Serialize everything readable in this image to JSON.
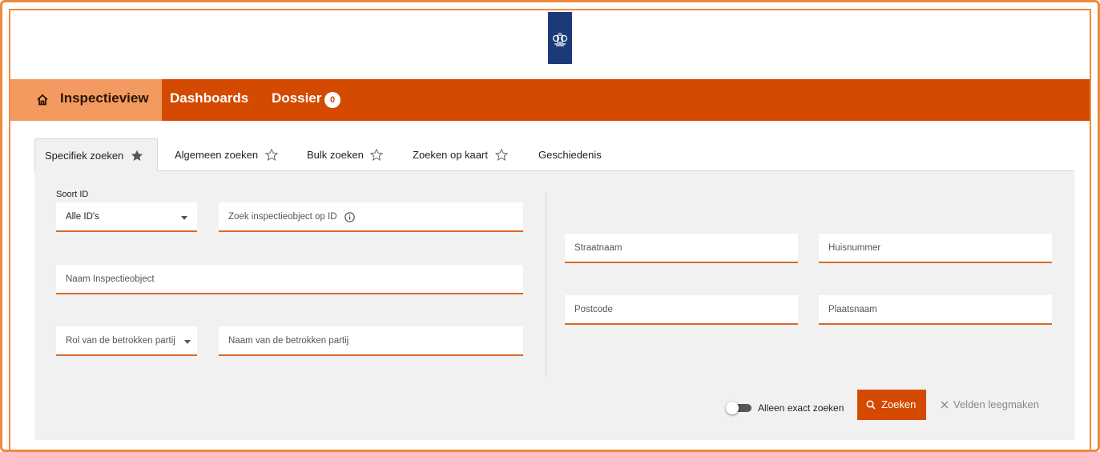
{
  "header": {
    "logo_icon": "rijksoverheid-logo"
  },
  "nav": {
    "home_icon": "home-icon",
    "items": [
      {
        "label": "Inspectieview"
      },
      {
        "label": "Dashboards"
      },
      {
        "label": "Dossier",
        "badge": "0"
      }
    ],
    "colors": {
      "bar": "#d44a00",
      "active": "#f39a60"
    }
  },
  "tabs": [
    {
      "label": "Specifiek zoeken",
      "icon": "star-filled-icon",
      "active": true
    },
    {
      "label": "Algemeen zoeken",
      "icon": "star-outline-icon"
    },
    {
      "label": "Bulk zoeken",
      "icon": "star-outline-icon"
    },
    {
      "label": "Zoeken op kaart",
      "icon": "star-outline-icon"
    },
    {
      "label": "Geschiedenis"
    }
  ],
  "form": {
    "soort_id": {
      "label": "Soort ID",
      "value": "Alle ID's"
    },
    "zoek_id": {
      "placeholder": "Zoek inspectieobject op ID",
      "icon": "info-icon"
    },
    "naam_inspectieobject": {
      "placeholder": "Naam Inspectieobject"
    },
    "rol": {
      "placeholder": "Rol van de betrokken partij"
    },
    "naam_partij": {
      "placeholder": "Naam van de betrokken partij"
    },
    "straatnaam": {
      "placeholder": "Straatnaam"
    },
    "huisnummer": {
      "placeholder": "Huisnummer"
    },
    "postcode": {
      "placeholder": "Postcode"
    },
    "plaatsnaam": {
      "placeholder": "Plaatsnaam"
    }
  },
  "actions": {
    "exact_toggle_label": "Alleen exact zoeken",
    "exact_toggle_on": false,
    "search_label": "Zoeken",
    "search_icon": "search-icon",
    "clear_label": "Velden leegmaken",
    "clear_icon": "close-icon"
  }
}
